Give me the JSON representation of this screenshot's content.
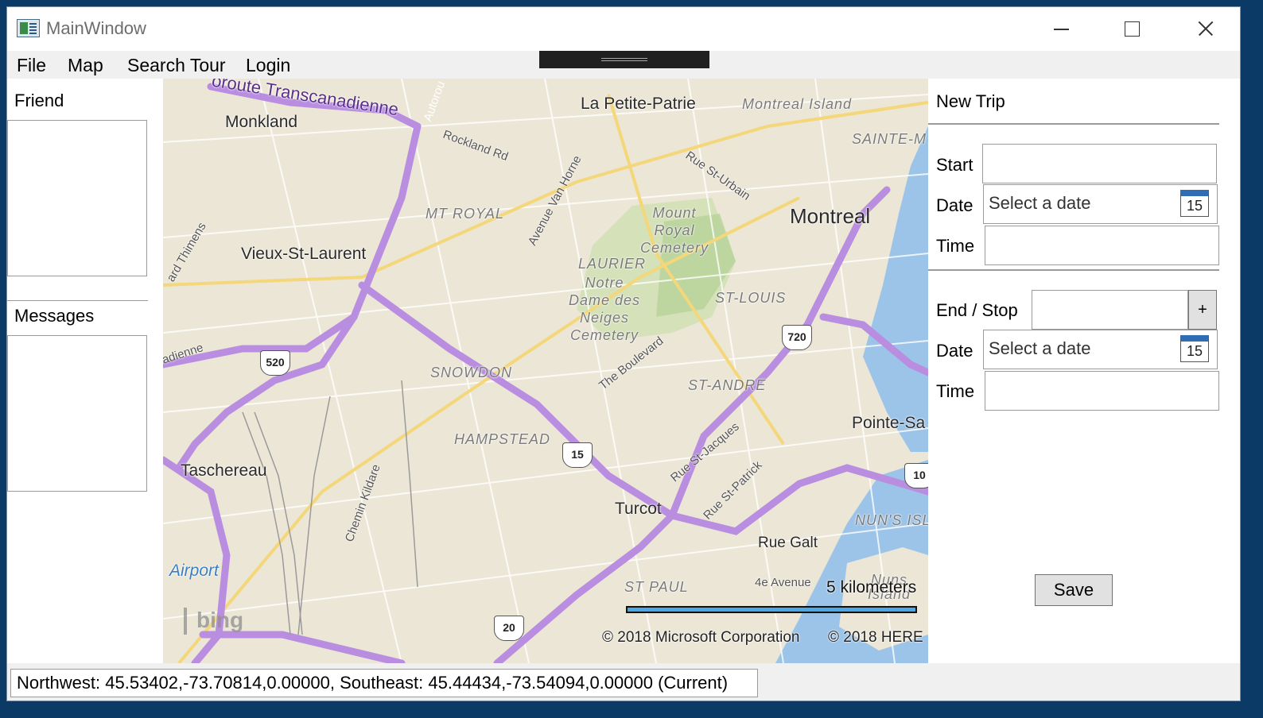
{
  "window": {
    "title": "MainWindow"
  },
  "menu": {
    "items": [
      "File",
      "Map",
      "Search Tour",
      "Login"
    ]
  },
  "left_panel": {
    "friend_label": "Friend",
    "messages_label": "Messages"
  },
  "map": {
    "labels": {
      "petite_patrie": "La Petite-Patrie",
      "montreal_island": "Montreal Island",
      "monkland": "Monkland",
      "transcanadienne": "oroute Transcanadienne",
      "autoroute": "Autorou",
      "rockland": "Rockland Rd",
      "sainte_m": "SAINTE-M",
      "rue_st_urbain": "Rue St-Urbain",
      "mt_royal": "MT ROYAL",
      "van_horne": "Avenue Van Horne",
      "mount_royal_cemetery": "Mount Royal Cemetery",
      "montreal": "Montreal",
      "thimens": "ard Thimens",
      "vieux_st_laurent": "Vieux-St-Laurent",
      "laurier": "LAURIER",
      "notre_dame_cemetery": "Notre Dame des Neiges Cemetery",
      "st_louis": "ST-LOUIS",
      "adienne": "adienne",
      "snowdon": "SNOWDON",
      "the_boulevard": "The Boulevard",
      "st_andre": "ST-ANDRE",
      "pointe_sa": "Pointe-Sa",
      "hampstead": "HAMPSTEAD",
      "rue_st_jacques": "Rue St-Jacques",
      "taschereau": "Taschereau",
      "chemin_kildare": "Chemin Kildare",
      "rue_st_patrick": "Rue St-Patrick",
      "turcot": "Turcot",
      "nuns_isl": "NUN'S ISL",
      "rue_galt": "Rue Galt",
      "airport": "Airport",
      "st_paul": "ST PAUL",
      "4e_avenue": "4e Avenue",
      "nuns_island": "Nuns Island"
    },
    "shields": [
      "520",
      "720",
      "15",
      "10",
      "20"
    ],
    "scale_text": "5 kilometers",
    "copyright_microsoft": "© 2018 Microsoft Corporation",
    "copyright_here": "© 2018 HERE",
    "logo_text": "bing",
    "colors": {
      "highway": "#b98ee0",
      "water": "#9cc3e8",
      "land": "#ece6d6",
      "park": "#cfe0b0"
    }
  },
  "trip": {
    "title": "New Trip",
    "start_label": "Start",
    "date_label": "Date",
    "date_placeholder": "Select a date",
    "calendar_day": "15",
    "time_label": "Time",
    "end_stop_label": "End / Stop",
    "add_label": "+",
    "save_label": "Save"
  },
  "status": {
    "text": "Northwest: 45.53402,-73.70814,0.00000, Southeast: 45.44434,-73.54094,0.00000 (Current)"
  }
}
